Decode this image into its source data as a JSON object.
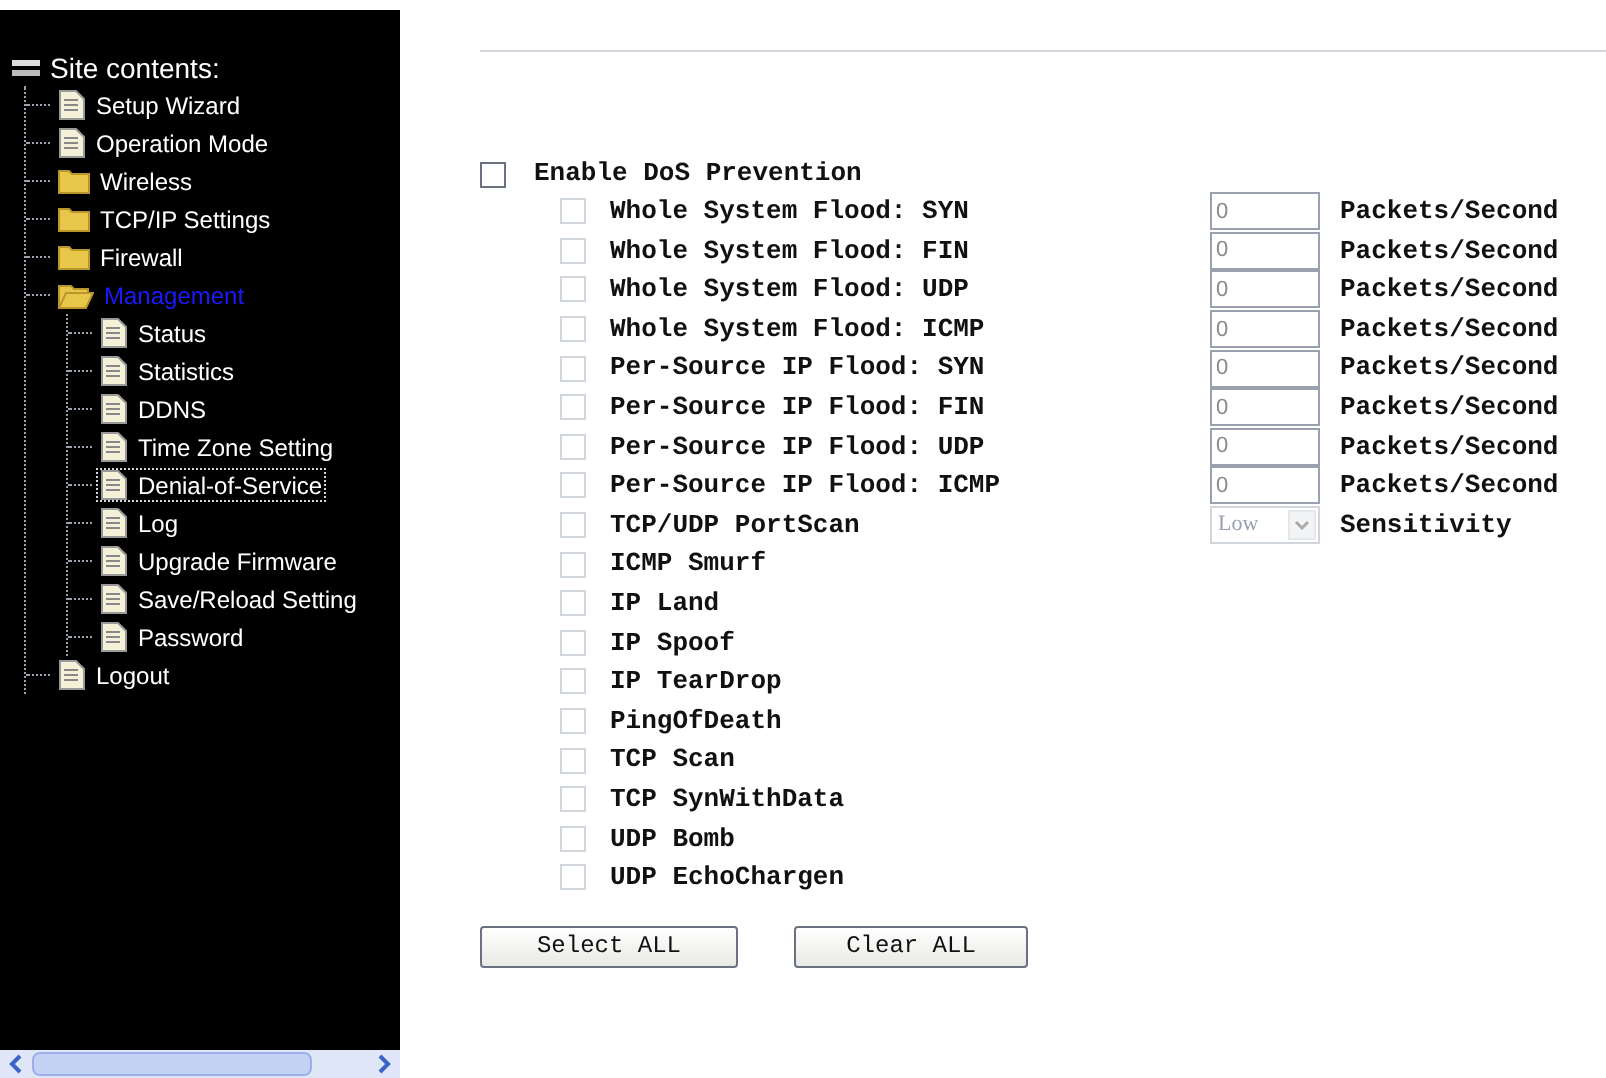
{
  "sidebar": {
    "title": "Site contents:",
    "items": [
      {
        "label": "Setup Wizard",
        "kind": "page",
        "selected": false
      },
      {
        "label": "Operation Mode",
        "kind": "page",
        "selected": false
      },
      {
        "label": "Wireless",
        "kind": "folder",
        "selected": false,
        "expanded": false
      },
      {
        "label": "TCP/IP Settings",
        "kind": "folder",
        "selected": false,
        "expanded": false
      },
      {
        "label": "Firewall",
        "kind": "folder",
        "selected": false,
        "expanded": false
      },
      {
        "label": "Management",
        "kind": "folder",
        "selected": true,
        "expanded": true,
        "children": [
          {
            "label": "Status",
            "kind": "page",
            "selected": false
          },
          {
            "label": "Statistics",
            "kind": "page",
            "selected": false
          },
          {
            "label": "DDNS",
            "kind": "page",
            "selected": false
          },
          {
            "label": "Time Zone Setting",
            "kind": "page",
            "selected": false
          },
          {
            "label": "Denial-of-Service",
            "kind": "page",
            "selected": true
          },
          {
            "label": "Log",
            "kind": "page",
            "selected": false
          },
          {
            "label": "Upgrade Firmware",
            "kind": "page",
            "selected": false
          },
          {
            "label": "Save/Reload Setting",
            "kind": "page",
            "selected": false
          },
          {
            "label": "Password",
            "kind": "page",
            "selected": false
          }
        ]
      },
      {
        "label": "Logout",
        "kind": "page",
        "selected": false
      }
    ]
  },
  "enable": {
    "label": "Enable DoS Prevention",
    "checked": false
  },
  "options": [
    {
      "label": "Whole System Flood: SYN",
      "kind": "rate",
      "checked": false,
      "disabled": true,
      "value": "0",
      "unit": "Packets/Second"
    },
    {
      "label": "Whole System Flood: FIN",
      "kind": "rate",
      "checked": false,
      "disabled": true,
      "value": "0",
      "unit": "Packets/Second"
    },
    {
      "label": "Whole System Flood: UDP",
      "kind": "rate",
      "checked": false,
      "disabled": true,
      "value": "0",
      "unit": "Packets/Second"
    },
    {
      "label": "Whole System Flood: ICMP",
      "kind": "rate",
      "checked": false,
      "disabled": true,
      "value": "0",
      "unit": "Packets/Second"
    },
    {
      "label": "Per-Source IP Flood: SYN",
      "kind": "rate",
      "checked": false,
      "disabled": true,
      "value": "0",
      "unit": "Packets/Second"
    },
    {
      "label": "Per-Source IP Flood: FIN",
      "kind": "rate",
      "checked": false,
      "disabled": true,
      "value": "0",
      "unit": "Packets/Second"
    },
    {
      "label": "Per-Source IP Flood: UDP",
      "kind": "rate",
      "checked": false,
      "disabled": true,
      "value": "0",
      "unit": "Packets/Second"
    },
    {
      "label": "Per-Source IP Flood: ICMP",
      "kind": "rate",
      "checked": false,
      "disabled": true,
      "value": "0",
      "unit": "Packets/Second"
    },
    {
      "label": "TCP/UDP PortScan",
      "kind": "select",
      "checked": false,
      "disabled": true,
      "value": "Low",
      "unit": "Sensitivity"
    },
    {
      "label": "ICMP Smurf",
      "kind": "plain",
      "checked": false,
      "disabled": true
    },
    {
      "label": "IP Land",
      "kind": "plain",
      "checked": false,
      "disabled": true
    },
    {
      "label": "IP Spoof",
      "kind": "plain",
      "checked": false,
      "disabled": true
    },
    {
      "label": "IP TearDrop",
      "kind": "plain",
      "checked": false,
      "disabled": true
    },
    {
      "label": "PingOfDeath",
      "kind": "plain",
      "checked": false,
      "disabled": true
    },
    {
      "label": "TCP Scan",
      "kind": "plain",
      "checked": false,
      "disabled": true
    },
    {
      "label": "TCP SynWithData",
      "kind": "plain",
      "checked": false,
      "disabled": true
    },
    {
      "label": "UDP Bomb",
      "kind": "plain",
      "checked": false,
      "disabled": true
    },
    {
      "label": "UDP EchoChargen",
      "kind": "plain",
      "checked": false,
      "disabled": true
    }
  ],
  "buttons": [
    "Select ALL",
    "Clear ALL"
  ]
}
